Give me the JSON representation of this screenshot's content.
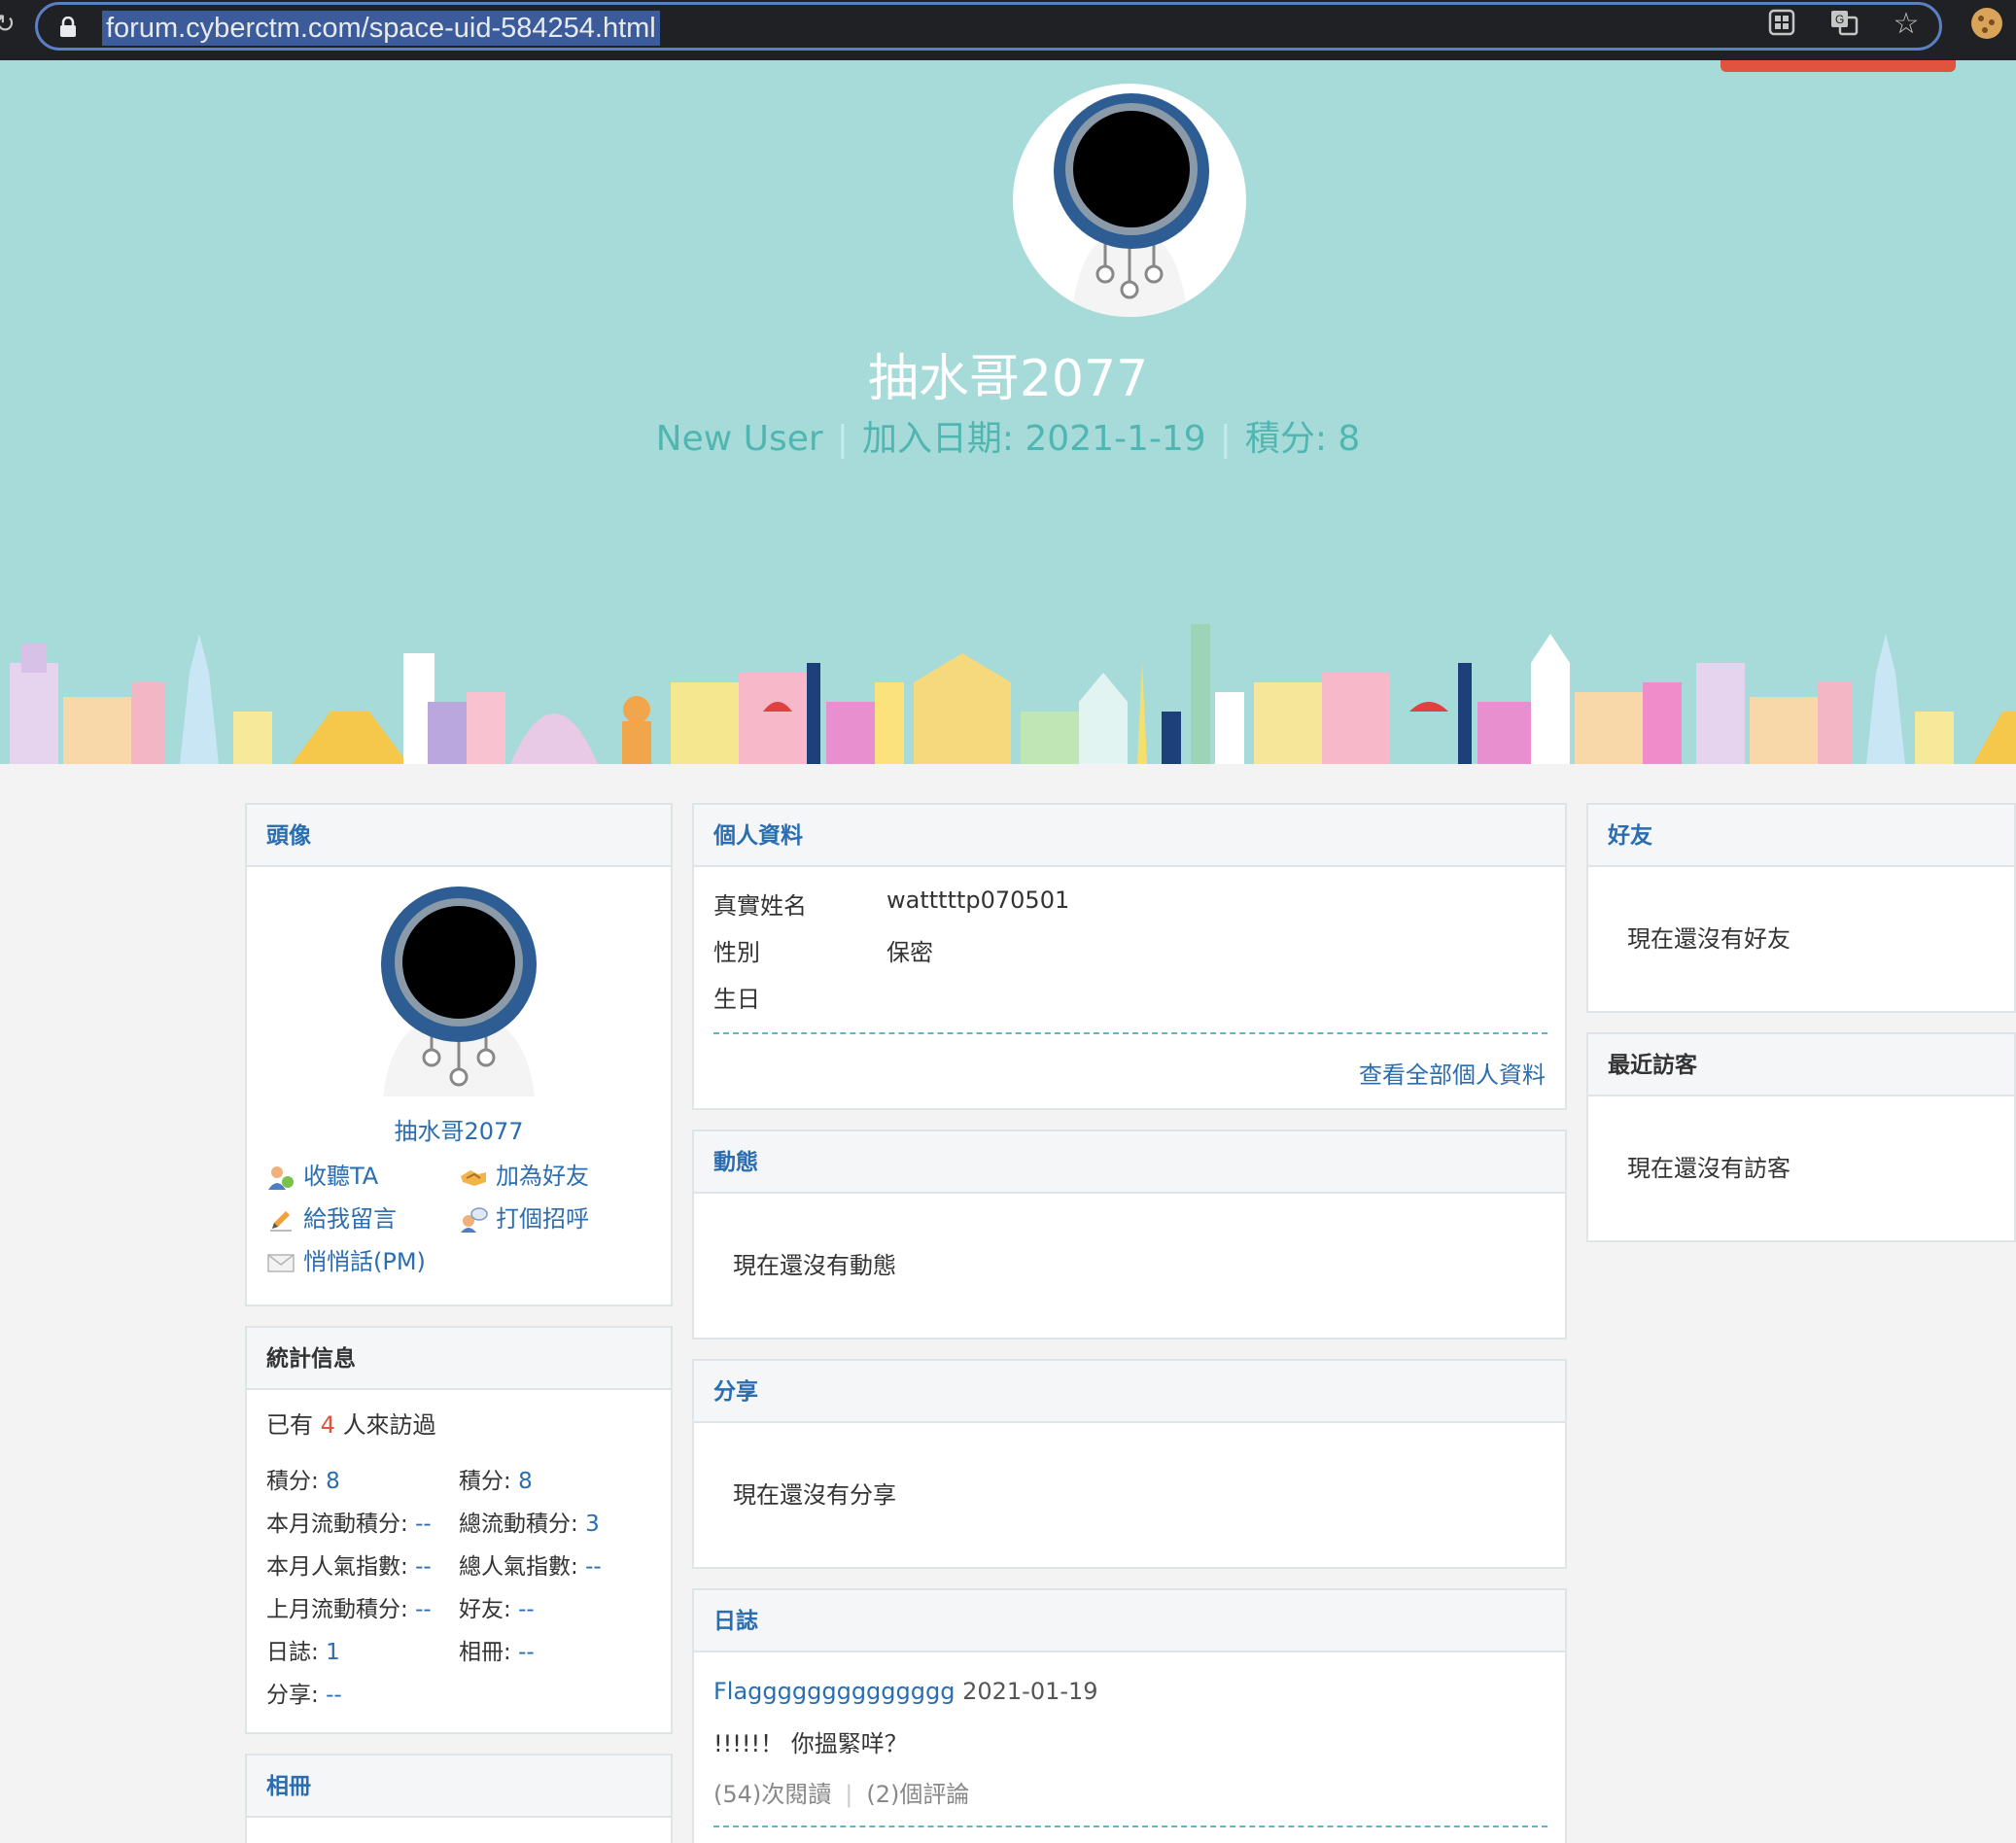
{
  "browser": {
    "url": "forum.cyberctm.com/space-uid-584254.html",
    "icons": [
      "lock-icon",
      "apps-icon",
      "translate-icon",
      "bookmark-star-icon",
      "cookie-extension-icon"
    ]
  },
  "header": {
    "username": "抽水哥2077",
    "rank": "New User",
    "join_date": "加入日期: 2021-1-19",
    "points": "積分: 8"
  },
  "left": {
    "avatar_panel": {
      "title": "頭像",
      "name": "抽水哥2077",
      "actions": {
        "follow": "收聽TA",
        "add_friend": "加為好友",
        "message": "給我留言",
        "greet": "打個招呼",
        "pm": "悄悄話(PM)"
      }
    },
    "stats_panel": {
      "title": "統計信息",
      "visitors_prefix": "已有",
      "visitors_count": "4",
      "visitors_suffix": "人來訪過",
      "items": [
        {
          "label": "積分: ",
          "value": "8"
        },
        {
          "label": "積分: ",
          "value": "8"
        },
        {
          "label": "本月流動積分: ",
          "value": "--"
        },
        {
          "label": "總流動積分: ",
          "value": "3"
        },
        {
          "label": "本月人氣指數: ",
          "value": "--"
        },
        {
          "label": "總人氣指數: ",
          "value": "--"
        },
        {
          "label": "上月流動積分: ",
          "value": "--"
        },
        {
          "label": "好友: ",
          "value": "--"
        },
        {
          "label": "日誌: ",
          "value": "1"
        },
        {
          "label": "相冊: ",
          "value": "--"
        },
        {
          "label": "分享: ",
          "value": "--"
        }
      ]
    },
    "album_panel": {
      "title": "相冊"
    }
  },
  "middle": {
    "profile_panel": {
      "title": "個人資料",
      "rows": [
        {
          "label": "真實姓名",
          "value": "watttttp070501"
        },
        {
          "label": "性別",
          "value": "保密"
        },
        {
          "label": "生日",
          "value": ""
        }
      ],
      "view_all": "查看全部個人資料"
    },
    "feed_panel": {
      "title": "動態",
      "empty": "現在還沒有動態"
    },
    "share_panel": {
      "title": "分享",
      "empty": "現在還沒有分享"
    },
    "blog_panel": {
      "title": "日誌",
      "post_title": "Flagggggggggggggg",
      "post_date": " 2021-01-19",
      "post_excerpt": "!!!!!！ 你搵緊咩？",
      "post_reads": "(54)次閱讀",
      "post_comments": "(2)個評論"
    }
  },
  "right": {
    "friends_panel": {
      "title": "好友",
      "empty": "現在還沒有好友"
    },
    "visitors_panel": {
      "title": "最近訪客",
      "empty": "現在還沒有訪客"
    }
  },
  "colors": {
    "banner": "#a7dbd9",
    "link": "#2a6db0",
    "accent_red": "#e2533d",
    "meta_teal": "#4fb6b2"
  }
}
